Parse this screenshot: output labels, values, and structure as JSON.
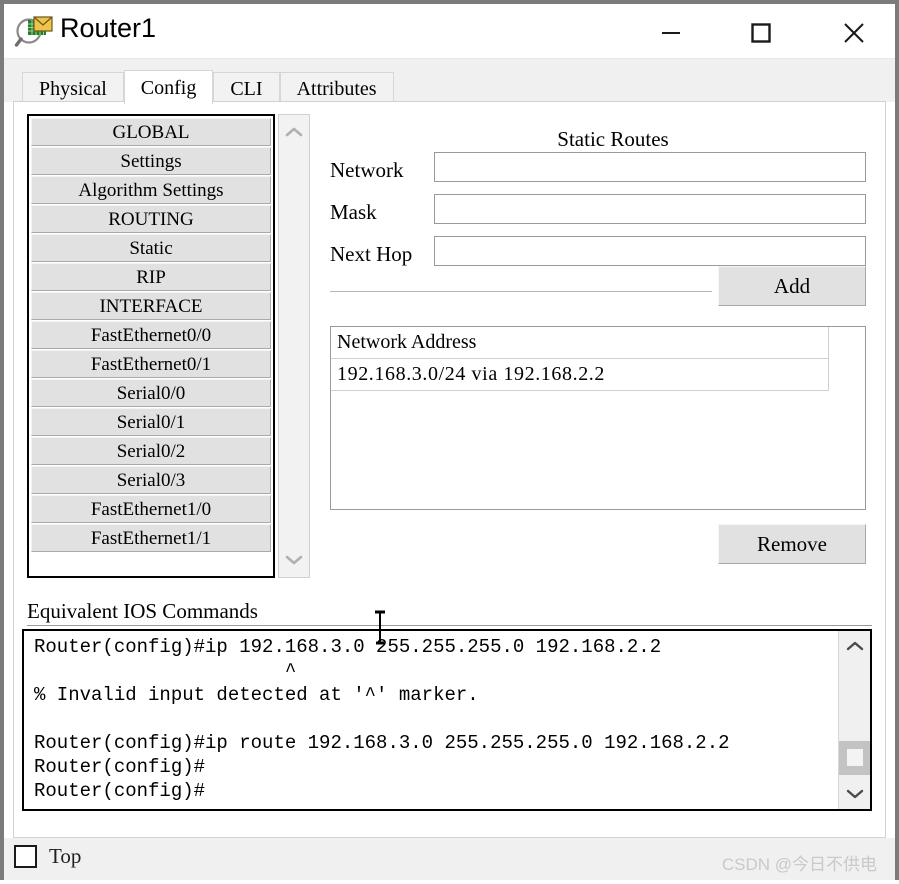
{
  "window": {
    "title": "Router1",
    "icon": "packet-tracer-device-icon",
    "controls": {
      "minimize": "minimize-icon",
      "maximize": "maximize-icon",
      "close": "close-icon"
    }
  },
  "tabs": [
    {
      "label": "Physical",
      "selected": false
    },
    {
      "label": "Config",
      "selected": true
    },
    {
      "label": "CLI",
      "selected": false
    },
    {
      "label": "Attributes",
      "selected": false
    }
  ],
  "sidebar": {
    "items": [
      {
        "label": "GLOBAL"
      },
      {
        "label": "Settings"
      },
      {
        "label": "Algorithm Settings"
      },
      {
        "label": "ROUTING"
      },
      {
        "label": "Static"
      },
      {
        "label": "RIP"
      },
      {
        "label": "INTERFACE"
      },
      {
        "label": "FastEthernet0/0"
      },
      {
        "label": "FastEthernet0/1"
      },
      {
        "label": "Serial0/0"
      },
      {
        "label": "Serial0/1"
      },
      {
        "label": "Serial0/2"
      },
      {
        "label": "Serial0/3"
      },
      {
        "label": "FastEthernet1/0"
      },
      {
        "label": "FastEthernet1/1"
      }
    ],
    "scroll": {
      "up": "chevron-up-icon",
      "down": "chevron-down-icon"
    }
  },
  "static_routes": {
    "title": "Static Routes",
    "fields": {
      "network_label": "Network",
      "network_value": "",
      "network_placeholder": "",
      "mask_label": "Mask",
      "mask_value": "",
      "mask_placeholder": "",
      "next_hop_label": "Next Hop",
      "next_hop_value": "",
      "next_hop_placeholder": ""
    },
    "add_label": "Add",
    "remove_label": "Remove",
    "table": {
      "header": "Network Address",
      "rows": [
        "192.168.3.0/24 via 192.168.2.2"
      ]
    }
  },
  "ios": {
    "label": "Equivalent IOS Commands",
    "text": "Router(config)#ip 192.168.3.0 255.255.255.0 192.168.2.2\n                      ^\n% Invalid input detected at '^' marker.\n\nRouter(config)#ip route 192.168.3.0 255.255.255.0 192.168.2.2\nRouter(config)#\nRouter(config)#",
    "scroll": {
      "up": "chevron-up-icon",
      "down": "chevron-down-icon"
    }
  },
  "bottom": {
    "top_checkbox_label": "Top",
    "top_checkbox_checked": false,
    "watermark": "CSDN @今日不供电"
  }
}
